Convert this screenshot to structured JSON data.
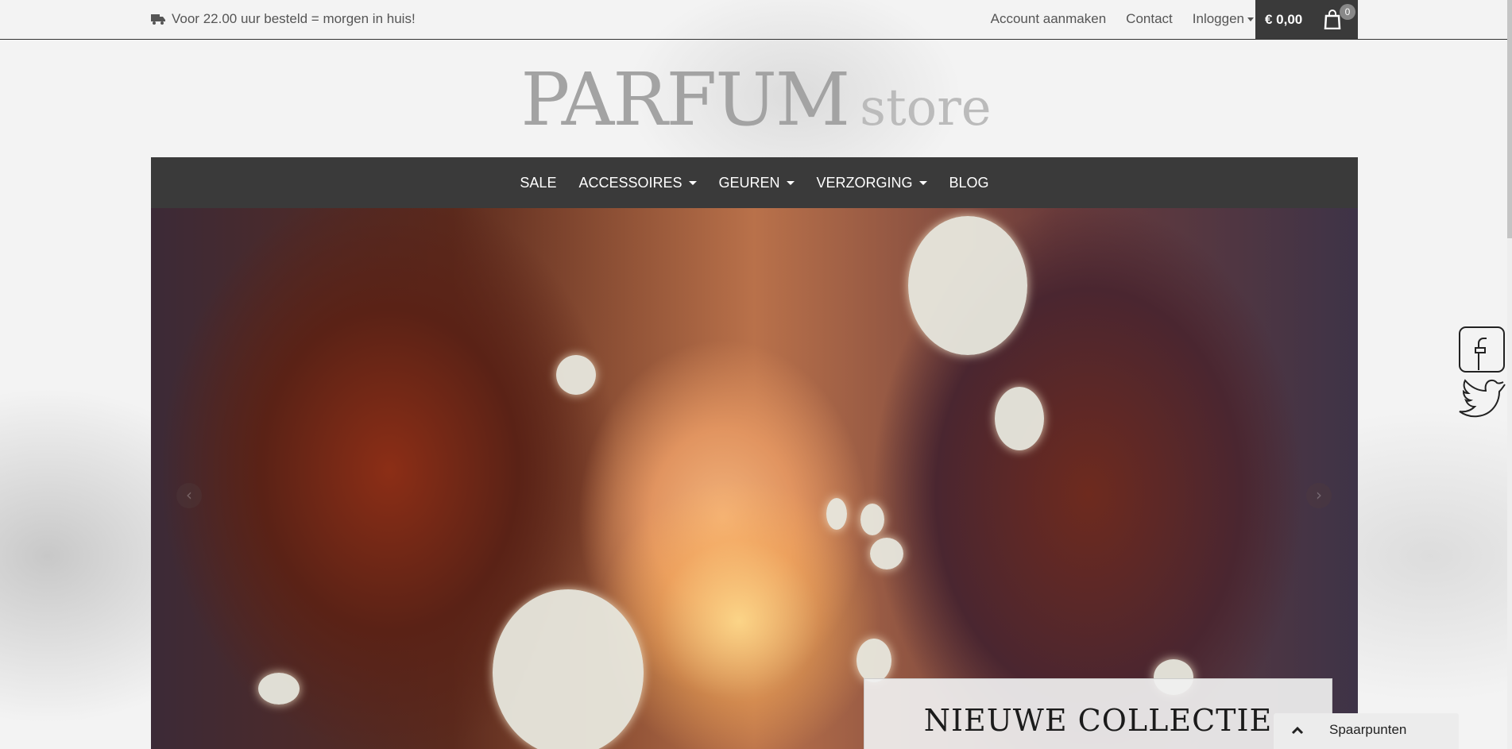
{
  "topbar": {
    "shipping_text": "Voor 22.00 uur besteld = morgen in huis!",
    "links": {
      "account": "Account aanmaken",
      "contact": "Contact",
      "login": "Inloggen"
    },
    "cart": {
      "total": "€ 0,00",
      "count": "0"
    }
  },
  "logo": {
    "main": "PARFUM",
    "sub": "store"
  },
  "nav": {
    "items": [
      {
        "label": "SALE"
      },
      {
        "label": "ACCESSOIRES"
      },
      {
        "label": "GEUREN"
      },
      {
        "label": "VERZORGING"
      },
      {
        "label": "BLOG"
      }
    ]
  },
  "hero": {
    "caption": "NIEUWE COLLECTIE",
    "prev_icon": "chevron-left-icon",
    "next_icon": "chevron-right-icon"
  },
  "social": {
    "facebook": "facebook-icon",
    "twitter": "twitter-icon"
  },
  "widget": {
    "label": "Spaarpunten",
    "icon": "chevron-up-icon"
  }
}
